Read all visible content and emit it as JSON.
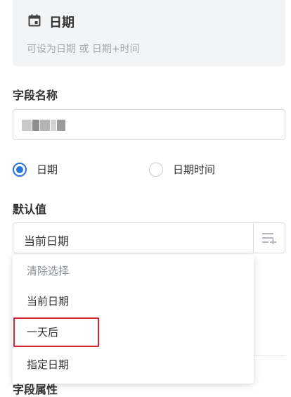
{
  "header": {
    "title": "日期",
    "description": "可设为日期 或 日期+时间",
    "icon": "calendar-icon"
  },
  "field_name": {
    "label": "字段名称",
    "value_obscured": true
  },
  "date_type": {
    "options": [
      {
        "label": "日期",
        "selected": true
      },
      {
        "label": "日期时间",
        "selected": false
      }
    ]
  },
  "default_value": {
    "label": "默认值",
    "selected": "当前日期",
    "button_icon": "list-add-icon"
  },
  "dropdown": {
    "items": [
      {
        "label": "清除选择"
      },
      {
        "label": "当前日期"
      },
      {
        "label": "一天后",
        "highlighted": true
      },
      {
        "label": "指定日期"
      }
    ]
  },
  "field_attributes": {
    "label": "字段属性"
  },
  "colors": {
    "accent": "#2e72de",
    "highlight_border": "#d6262f",
    "header_bg": "#f3f4f6"
  }
}
